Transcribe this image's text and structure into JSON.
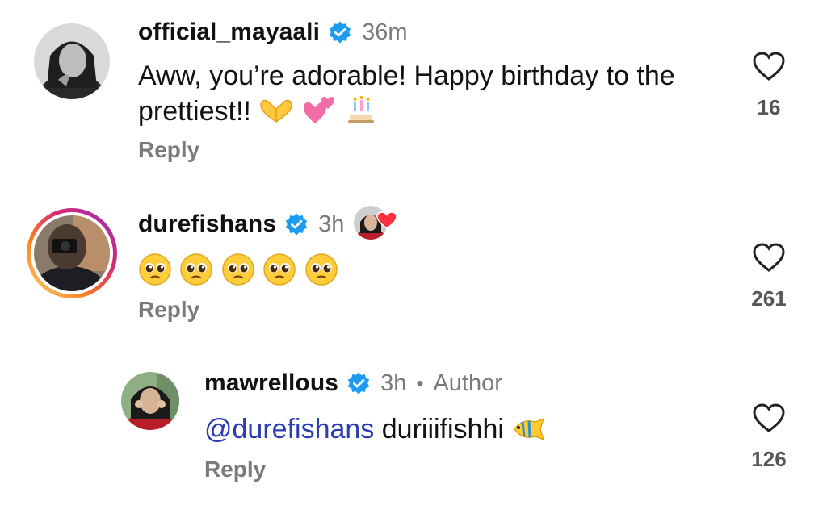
{
  "comments": [
    {
      "username": "official_mayaali",
      "time": "36m",
      "text": "Aww, you’re adorable! Happy birthday to the prettiest!!",
      "emojis": [
        "heart-hands",
        "two-hearts",
        "birthday-cake"
      ],
      "reply_label": "Reply",
      "likes": "16"
    },
    {
      "username": "durefishans",
      "time": "3h",
      "liked_by_author": true,
      "emojis": [
        "pleading-face",
        "pleading-face",
        "pleading-face",
        "pleading-face",
        "pleading-face"
      ],
      "reply_label": "Reply",
      "likes": "261",
      "story_ring": true
    },
    {
      "username": "mawrellous",
      "time": "3h",
      "dot": "•",
      "author_tag": "Author",
      "mention_symbol": "@",
      "mention": "durefishans",
      "text": "duriiifishhi",
      "emojis": [
        "tropical-fish"
      ],
      "reply_label": "Reply",
      "likes": "126"
    }
  ],
  "colors": {
    "verified": "#1d9bf0",
    "secondary_text": "#7a7a7a",
    "mention": "#2b3cb4",
    "like_heart": "#ff3040"
  }
}
